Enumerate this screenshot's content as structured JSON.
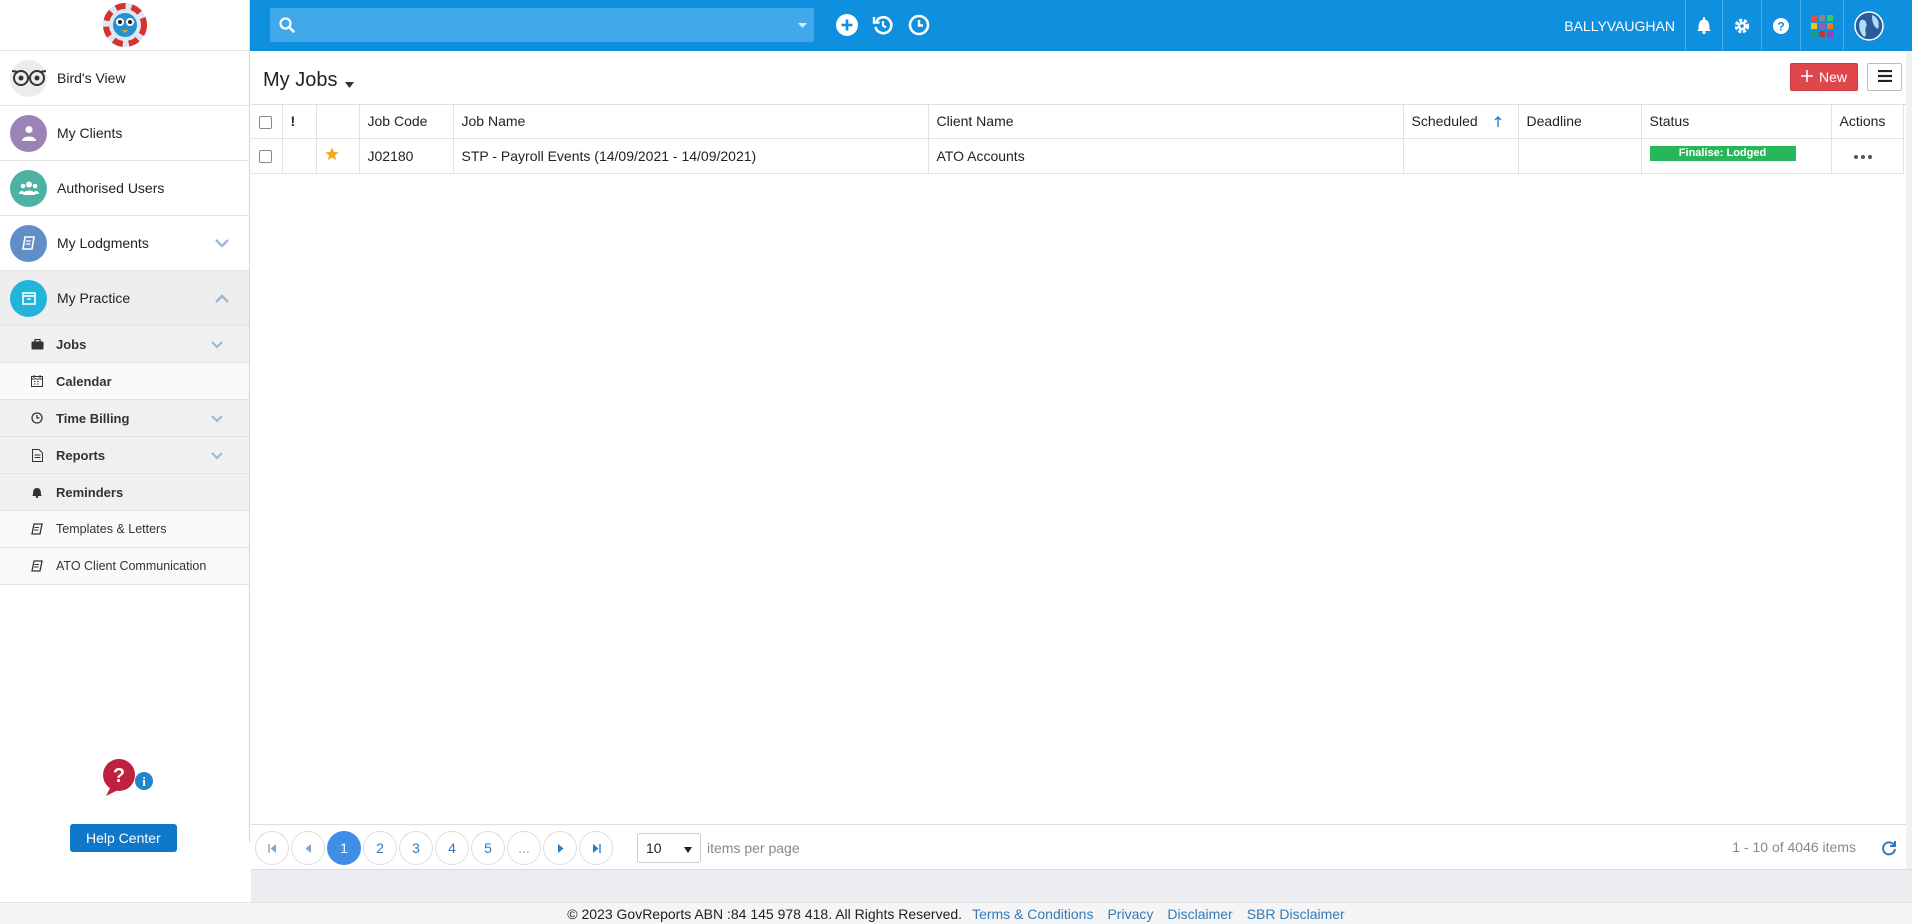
{
  "sidebar": {
    "items": [
      {
        "label": "Bird's View",
        "icon": "owl-icon",
        "color": "#e8e8e8"
      },
      {
        "label": "My Clients",
        "icon": "user-icon",
        "color": "#9b83b6"
      },
      {
        "label": "Authorised Users",
        "icon": "users-icon",
        "color": "#4fb1a3"
      },
      {
        "label": "My Lodgments",
        "icon": "book-icon",
        "color": "#5f8fc6"
      },
      {
        "label": "My Practice",
        "icon": "practice-icon",
        "color": "#23b5d9"
      }
    ],
    "sub_items": [
      {
        "label": "Jobs",
        "icon": "briefcase-icon"
      },
      {
        "label": "Calendar",
        "icon": "calendar-icon"
      },
      {
        "label": "Time Billing",
        "icon": "clock-icon"
      },
      {
        "label": "Reports",
        "icon": "report-icon"
      },
      {
        "label": "Reminders",
        "icon": "bell-icon"
      },
      {
        "label": "Templates & Letters",
        "icon": "book-icon"
      },
      {
        "label": "ATO Client Communication",
        "icon": "book-icon"
      }
    ],
    "help_label": "Help Center"
  },
  "topbar": {
    "search_placeholder": "",
    "username": "BALLYVAUGHAN"
  },
  "main": {
    "title": "My Jobs",
    "new_button": "New",
    "columns": [
      "!",
      "Job Code",
      "Job Name",
      "Client Name",
      "Scheduled",
      "Deadline",
      "Status",
      "Actions"
    ],
    "rows": [
      {
        "job_code": "J02180",
        "job_name": "STP - Payroll Events (14/09/2021 - 14/09/2021)",
        "client_name": "ATO Accounts",
        "scheduled": "",
        "deadline": "",
        "status": "Finalise: Lodged",
        "starred": true
      }
    ]
  },
  "pager": {
    "pages": [
      "1",
      "2",
      "3",
      "4",
      "5",
      "..."
    ],
    "current": "1",
    "per_page": "10",
    "per_page_label": "items per page",
    "info": "1 - 10 of 4046 items"
  },
  "footer": {
    "copyright": "© 2023 GovReports ABN :84 145 978 418. All Rights Reserved.",
    "links": [
      "Terms & Conditions",
      "Privacy",
      "Disclaimer",
      "SBR Disclaimer"
    ]
  },
  "colors": {
    "topbar": "#0f90df",
    "new_button": "#e0474c",
    "status_badge": "#28b65a",
    "help_button": "#0f78c8",
    "current_page": "#3f8fe8"
  }
}
